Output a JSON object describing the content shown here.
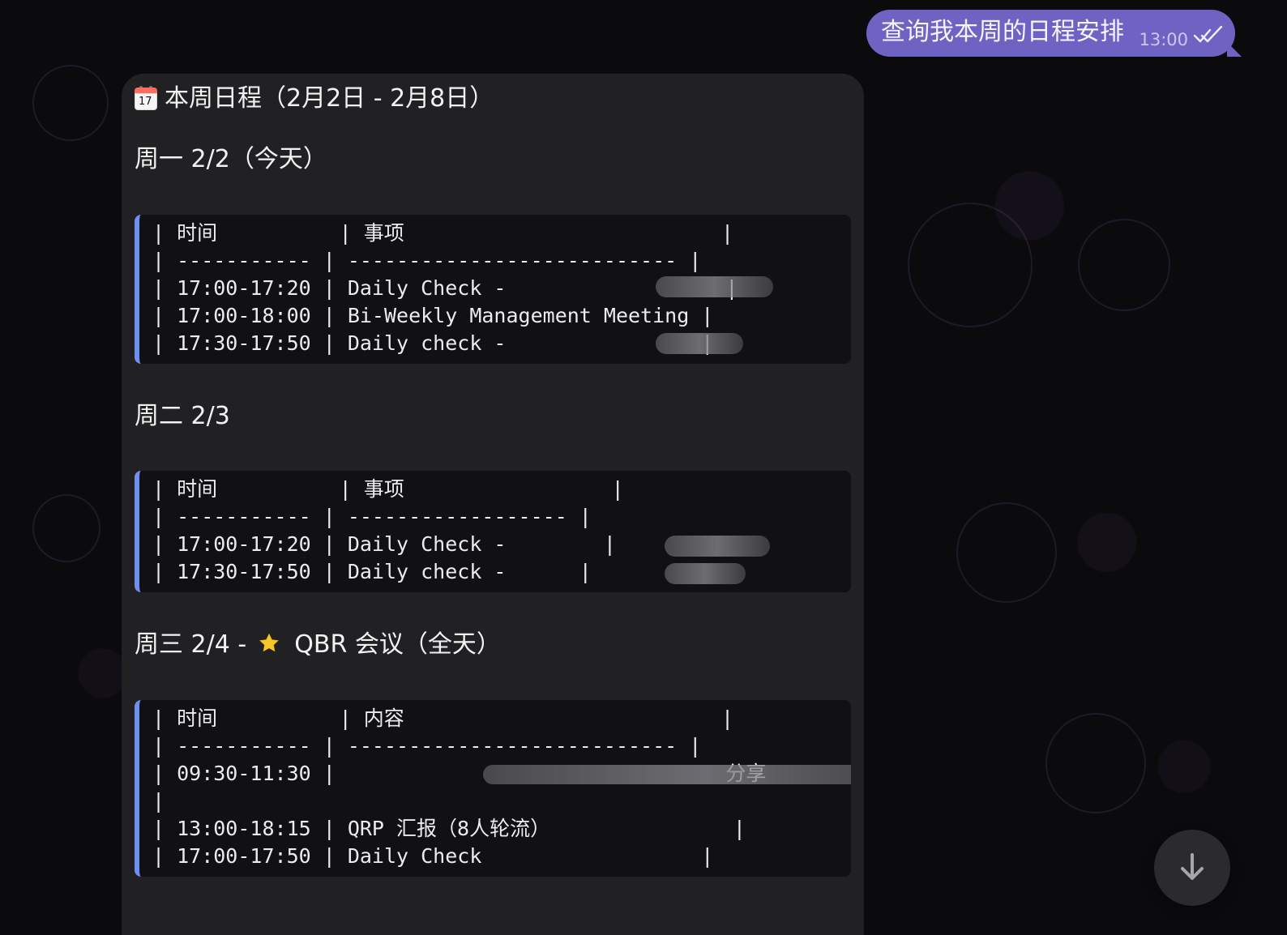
{
  "outgoing_message": {
    "text": "查询我本周的日程安排",
    "time": "13:00"
  },
  "incoming_message": {
    "header_title": "本周日程（2月2日 - 2月8日）",
    "calendar_icon_number": "17",
    "sections": [
      {
        "title": "周一 2/2（今天）",
        "lines": [
          "| 时间          | 事项                          |",
          "| ----------- | --------------------------- |",
          "| 17:00-17:20 | Daily Check -                  |",
          "| 17:00-18:00 | Bi-Weekly Management Meeting |",
          "| 17:30-17:50 | Daily check -                |"
        ]
      },
      {
        "title": "周二 2/3",
        "lines": [
          "| 时间          | 事项                 |",
          "| ----------- | ------------------ |",
          "| 17:00-17:20 | Daily Check -        |",
          "| 17:30-17:50 | Daily check -      |"
        ]
      },
      {
        "title_before_star": "周三 2/4 -",
        "title_after_star": "QBR 会议（全天）",
        "lines": [
          "| 时间          | 内容                          |",
          "| ----------- | --------------------------- |",
          "| 09:30-11:30 |                                分享",
          "|",
          "| 13:00-18:15 | QRP 汇报（8人轮流）               |",
          "| 17:00-17:50 | Daily Check                  |"
        ]
      }
    ]
  },
  "icons": {
    "calendar": "calendar-icon",
    "star": "star-icon",
    "read_receipt": "double-check-icon",
    "scroll": "arrow-down-icon"
  },
  "colors": {
    "background": "#0b0a0d",
    "outgoing_bubble": "#6e63c3",
    "incoming_bubble": "#212124",
    "code_background": "#111114",
    "code_accent": "#6f8ff0"
  }
}
